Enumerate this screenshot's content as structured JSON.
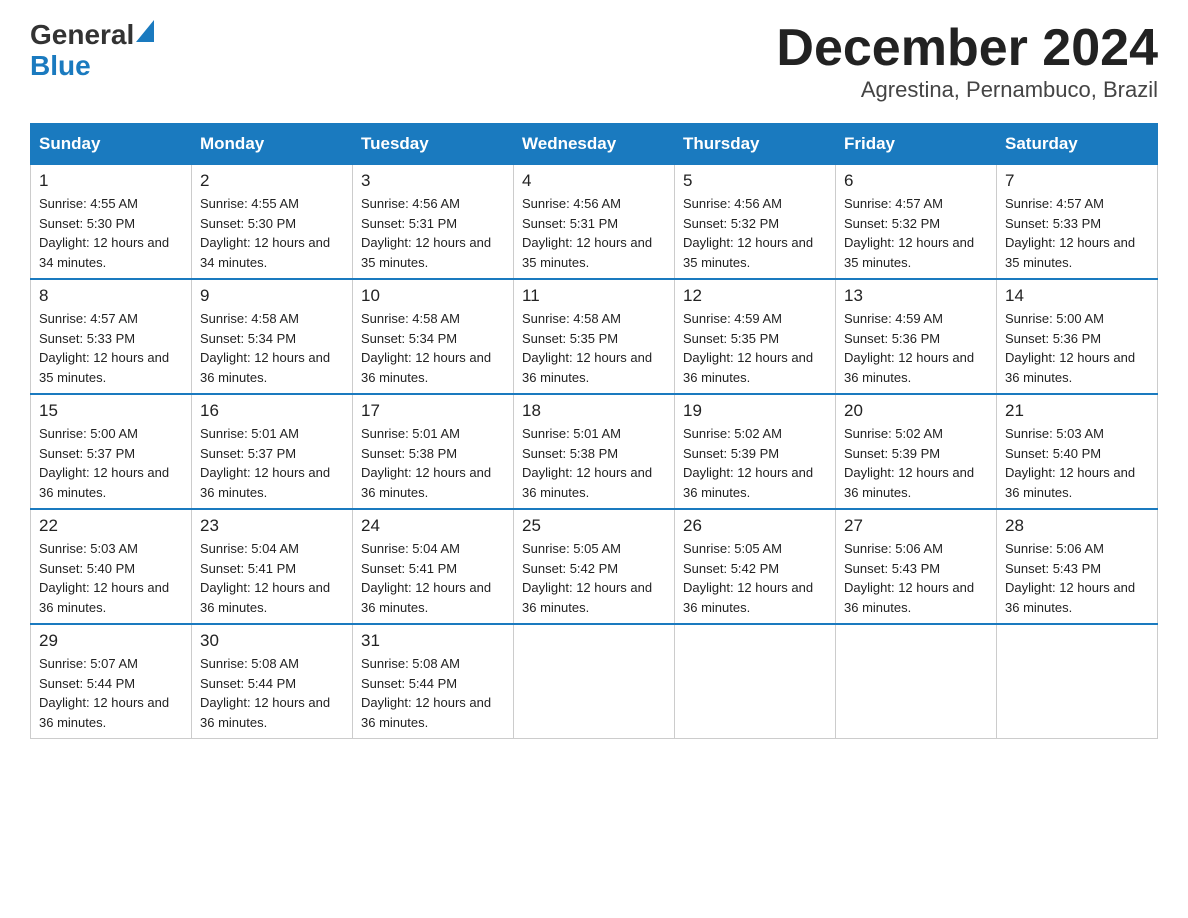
{
  "header": {
    "logo_general": "General",
    "logo_blue": "Blue",
    "month_title": "December 2024",
    "location": "Agrestina, Pernambuco, Brazil"
  },
  "weekdays": [
    "Sunday",
    "Monday",
    "Tuesday",
    "Wednesday",
    "Thursday",
    "Friday",
    "Saturday"
  ],
  "weeks": [
    [
      {
        "day": "1",
        "sunrise": "4:55 AM",
        "sunset": "5:30 PM",
        "daylight": "12 hours and 34 minutes."
      },
      {
        "day": "2",
        "sunrise": "4:55 AM",
        "sunset": "5:30 PM",
        "daylight": "12 hours and 34 minutes."
      },
      {
        "day": "3",
        "sunrise": "4:56 AM",
        "sunset": "5:31 PM",
        "daylight": "12 hours and 35 minutes."
      },
      {
        "day": "4",
        "sunrise": "4:56 AM",
        "sunset": "5:31 PM",
        "daylight": "12 hours and 35 minutes."
      },
      {
        "day": "5",
        "sunrise": "4:56 AM",
        "sunset": "5:32 PM",
        "daylight": "12 hours and 35 minutes."
      },
      {
        "day": "6",
        "sunrise": "4:57 AM",
        "sunset": "5:32 PM",
        "daylight": "12 hours and 35 minutes."
      },
      {
        "day": "7",
        "sunrise": "4:57 AM",
        "sunset": "5:33 PM",
        "daylight": "12 hours and 35 minutes."
      }
    ],
    [
      {
        "day": "8",
        "sunrise": "4:57 AM",
        "sunset": "5:33 PM",
        "daylight": "12 hours and 35 minutes."
      },
      {
        "day": "9",
        "sunrise": "4:58 AM",
        "sunset": "5:34 PM",
        "daylight": "12 hours and 36 minutes."
      },
      {
        "day": "10",
        "sunrise": "4:58 AM",
        "sunset": "5:34 PM",
        "daylight": "12 hours and 36 minutes."
      },
      {
        "day": "11",
        "sunrise": "4:58 AM",
        "sunset": "5:35 PM",
        "daylight": "12 hours and 36 minutes."
      },
      {
        "day": "12",
        "sunrise": "4:59 AM",
        "sunset": "5:35 PM",
        "daylight": "12 hours and 36 minutes."
      },
      {
        "day": "13",
        "sunrise": "4:59 AM",
        "sunset": "5:36 PM",
        "daylight": "12 hours and 36 minutes."
      },
      {
        "day": "14",
        "sunrise": "5:00 AM",
        "sunset": "5:36 PM",
        "daylight": "12 hours and 36 minutes."
      }
    ],
    [
      {
        "day": "15",
        "sunrise": "5:00 AM",
        "sunset": "5:37 PM",
        "daylight": "12 hours and 36 minutes."
      },
      {
        "day": "16",
        "sunrise": "5:01 AM",
        "sunset": "5:37 PM",
        "daylight": "12 hours and 36 minutes."
      },
      {
        "day": "17",
        "sunrise": "5:01 AM",
        "sunset": "5:38 PM",
        "daylight": "12 hours and 36 minutes."
      },
      {
        "day": "18",
        "sunrise": "5:01 AM",
        "sunset": "5:38 PM",
        "daylight": "12 hours and 36 minutes."
      },
      {
        "day": "19",
        "sunrise": "5:02 AM",
        "sunset": "5:39 PM",
        "daylight": "12 hours and 36 minutes."
      },
      {
        "day": "20",
        "sunrise": "5:02 AM",
        "sunset": "5:39 PM",
        "daylight": "12 hours and 36 minutes."
      },
      {
        "day": "21",
        "sunrise": "5:03 AM",
        "sunset": "5:40 PM",
        "daylight": "12 hours and 36 minutes."
      }
    ],
    [
      {
        "day": "22",
        "sunrise": "5:03 AM",
        "sunset": "5:40 PM",
        "daylight": "12 hours and 36 minutes."
      },
      {
        "day": "23",
        "sunrise": "5:04 AM",
        "sunset": "5:41 PM",
        "daylight": "12 hours and 36 minutes."
      },
      {
        "day": "24",
        "sunrise": "5:04 AM",
        "sunset": "5:41 PM",
        "daylight": "12 hours and 36 minutes."
      },
      {
        "day": "25",
        "sunrise": "5:05 AM",
        "sunset": "5:42 PM",
        "daylight": "12 hours and 36 minutes."
      },
      {
        "day": "26",
        "sunrise": "5:05 AM",
        "sunset": "5:42 PM",
        "daylight": "12 hours and 36 minutes."
      },
      {
        "day": "27",
        "sunrise": "5:06 AM",
        "sunset": "5:43 PM",
        "daylight": "12 hours and 36 minutes."
      },
      {
        "day": "28",
        "sunrise": "5:06 AM",
        "sunset": "5:43 PM",
        "daylight": "12 hours and 36 minutes."
      }
    ],
    [
      {
        "day": "29",
        "sunrise": "5:07 AM",
        "sunset": "5:44 PM",
        "daylight": "12 hours and 36 minutes."
      },
      {
        "day": "30",
        "sunrise": "5:08 AM",
        "sunset": "5:44 PM",
        "daylight": "12 hours and 36 minutes."
      },
      {
        "day": "31",
        "sunrise": "5:08 AM",
        "sunset": "5:44 PM",
        "daylight": "12 hours and 36 minutes."
      },
      null,
      null,
      null,
      null
    ]
  ]
}
